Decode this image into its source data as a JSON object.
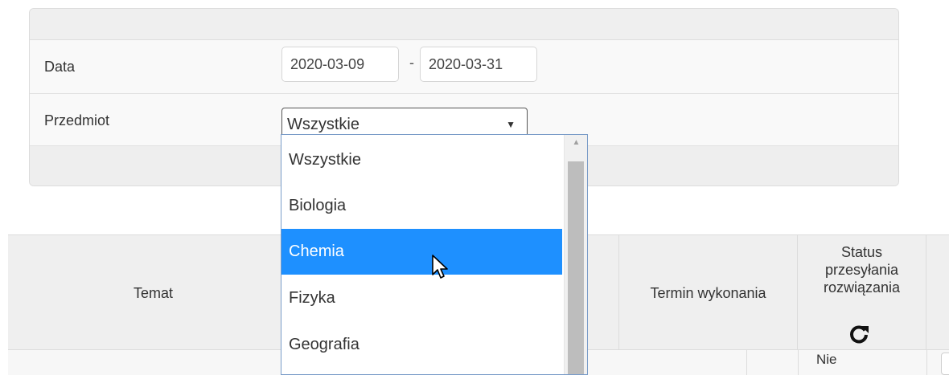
{
  "filters": {
    "date_label": "Data",
    "date_from": "2020-03-09",
    "date_separator": "-",
    "date_to": "2020-03-31",
    "subject_label": "Przedmiot",
    "subject_selected": "Wszystkie",
    "subject_options": [
      "Wszystkie",
      "Biologia",
      "Chemia",
      "Fizyka",
      "Geografia"
    ],
    "highlighted_option": "Chemia"
  },
  "table": {
    "headers": {
      "topic": "Temat",
      "deadline": "Termin wykonania",
      "status_line1": "Status",
      "status_line2": "przesyłania",
      "status_line3": "rozwiązania"
    },
    "first_row": {
      "status": "Nie"
    }
  },
  "colors": {
    "highlight": "#1e90ff",
    "panel_bg": "#f5f5f5",
    "border": "#dcdcdc"
  },
  "icons": {
    "refresh": "refresh-icon",
    "dropdown_arrow": "caret-down-icon",
    "cursor": "mouse-pointer-icon"
  }
}
